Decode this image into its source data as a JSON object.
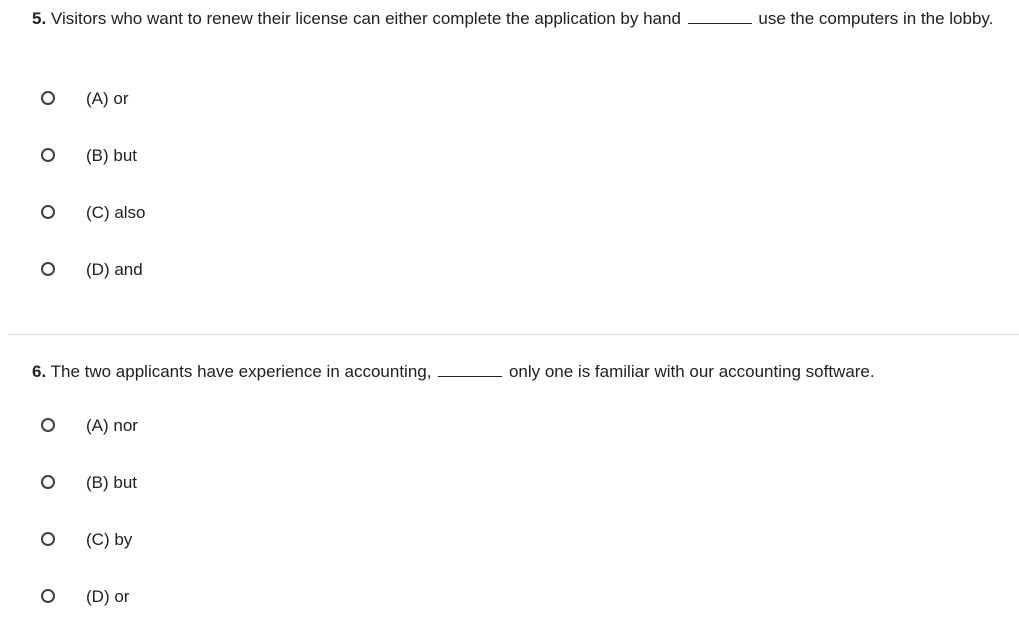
{
  "questions": [
    {
      "number": "5.",
      "text_before": "Visitors who want to renew their license can either complete the application by hand",
      "text_after": "use the computers in the lobby.",
      "options": [
        {
          "label": "(A) or"
        },
        {
          "label": "(B) but"
        },
        {
          "label": "(C) also"
        },
        {
          "label": "(D) and"
        }
      ]
    },
    {
      "number": "6.",
      "text_before": "The two applicants have experience in accounting,",
      "text_after": "only one is familiar with our accounting software.",
      "options": [
        {
          "label": "(A) nor"
        },
        {
          "label": "(B) but"
        },
        {
          "label": "(C) by"
        },
        {
          "label": "(D) or"
        }
      ]
    }
  ]
}
